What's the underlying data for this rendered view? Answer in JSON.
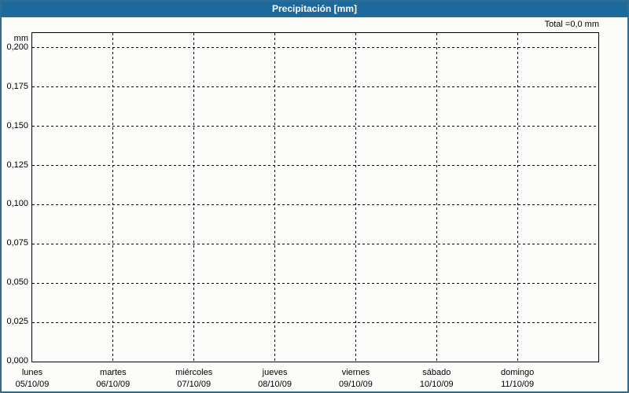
{
  "header": {
    "title": "Precipitación [mm]"
  },
  "summary": {
    "total_text": "Total =0,0 mm"
  },
  "colors": {
    "titlebar_bg": "#1e699c",
    "page_border": "#2d6c95",
    "page_bg": "#fcfdfa",
    "plot_border": "#000000",
    "grid": "#000000",
    "title_text": "#ffffff",
    "label_text": "#000000"
  },
  "chart_data": {
    "type": "bar",
    "title": "Precipitación [mm]",
    "ylabel": "mm",
    "total_text": "Total =0,0 mm",
    "x_labels": [
      {
        "day": "lunes",
        "date": "05/10/09"
      },
      {
        "day": "martes",
        "date": "06/10/09"
      },
      {
        "day": "miércoles",
        "date": "07/10/09"
      },
      {
        "day": "jueves",
        "date": "08/10/09"
      },
      {
        "day": "viernes",
        "date": "09/10/09"
      },
      {
        "day": "sábado",
        "date": "10/10/09"
      },
      {
        "day": "domingo",
        "date": "11/10/09"
      }
    ],
    "series": [
      {
        "name": "Precipitación",
        "values": [
          0,
          0,
          0,
          0,
          0,
          0,
          0
        ]
      }
    ],
    "total_mm": "0,0",
    "y_tick_values": [
      0,
      0.025,
      0.05,
      0.075,
      0.1,
      0.125,
      0.15,
      0.175,
      0.2
    ],
    "y_tick_labels": [
      "0,000",
      "0,025",
      "0,050",
      "0,075",
      "0,100",
      "0,125",
      "0,150",
      "0,175",
      "0,200"
    ],
    "ylim": [
      0,
      0.2095
    ],
    "grid": "dashed",
    "legend": "none"
  }
}
